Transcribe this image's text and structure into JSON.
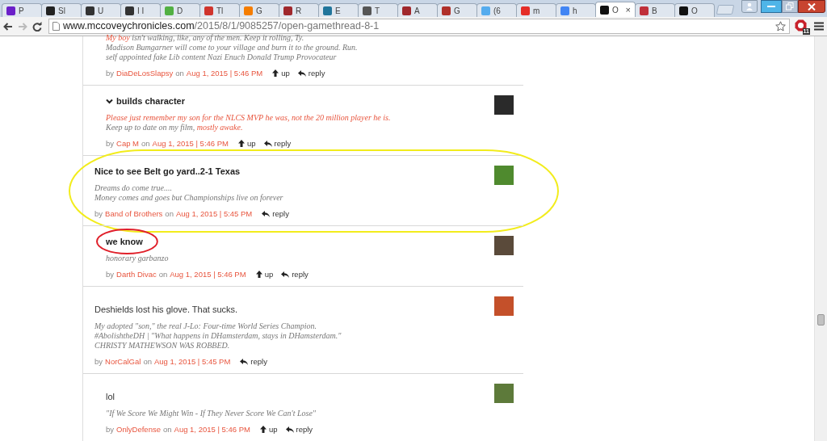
{
  "browser": {
    "tabs": [
      {
        "title": "P",
        "color": "#6b1fc9",
        "selected": false
      },
      {
        "title": "Sl",
        "color": "#222222",
        "selected": false
      },
      {
        "title": "U",
        "color": "#333333",
        "selected": false
      },
      {
        "title": "I I",
        "color": "#333333",
        "selected": false
      },
      {
        "title": "D",
        "color": "#52b043",
        "selected": false
      },
      {
        "title": "Tl",
        "color": "#d0342c",
        "selected": false
      },
      {
        "title": "G",
        "color": "#f57d00",
        "selected": false
      },
      {
        "title": "R",
        "color": "#a0282c",
        "selected": false
      },
      {
        "title": "E",
        "color": "#21759b",
        "selected": false
      },
      {
        "title": "T",
        "color": "#555555",
        "selected": false
      },
      {
        "title": "A",
        "color": "#a0282c",
        "selected": false
      },
      {
        "title": "G",
        "color": "#b0302a",
        "selected": false
      },
      {
        "title": "(6",
        "color": "#55acee",
        "selected": false
      },
      {
        "title": "m",
        "color": "#e52d27",
        "selected": false
      },
      {
        "title": "h",
        "color": "#4285f4",
        "selected": false
      },
      {
        "title": "O",
        "color": "#111111",
        "selected": true,
        "close": "×"
      },
      {
        "title": "B",
        "color": "#c0303a",
        "selected": false
      },
      {
        "title": "O",
        "color": "#111111",
        "selected": false
      }
    ],
    "url_host": "www.mccoveychronicles.com",
    "url_path": "/2015/8/1/9085257/open-gamethread-8-1",
    "forward_disabled": true,
    "extension_badge": "11"
  },
  "comments": [
    {
      "children": [
        {
          "signature": [
            [
              {
                "text": "My boy",
                "link": true
              },
              {
                "text": " isn't walking, like, any of the men. Keep it rolling, Ty.",
                "link": false
              }
            ],
            [
              {
                "text": "Madison Bumgarner will come to your village and burn it to the ground. Run.",
                "link": false
              }
            ],
            [
              {
                "text": "self appointed fake Lib content Nazi Enuch Donald Trump Provocateur",
                "link": false
              }
            ]
          ],
          "by": "by",
          "author": "DiaDeLosSlapsy",
          "on": "on",
          "date": "Aug 1, 2015 | 5:46 PM",
          "actions": [
            {
              "kind": "up",
              "label": "up"
            },
            {
              "kind": "reply",
              "label": "reply"
            }
          ]
        },
        {
          "title": "builds character",
          "title_bold": true,
          "expanded": true,
          "color": "#2a2a2a",
          "signature": [
            [
              {
                "text": "Please just remember my son for the NLCS MVP he was, not the 20 million player he is.",
                "link": true
              }
            ],
            [
              {
                "text": "Keep up to date on my film, ",
                "link": false
              },
              {
                "text": "mostly awake.",
                "link": true
              }
            ]
          ],
          "by": "by",
          "author": "Cap M",
          "on": "on",
          "date": "Aug 1, 2015 | 5:46 PM",
          "actions": [
            {
              "kind": "up",
              "label": "up"
            },
            {
              "kind": "reply",
              "label": "reply"
            }
          ]
        }
      ]
    },
    {
      "title": "Nice to see Belt go yard..2-1 Texas",
      "title_bold": true,
      "color": "#4f8a2e",
      "marker": {
        "color": "#f2ec1c"
      },
      "signature": [
        [
          {
            "text": "Dreams do come true....",
            "link": false
          }
        ],
        [
          {
            "text": "Money comes and goes but Championships live on forever",
            "link": false
          }
        ]
      ],
      "by": "by",
      "author": "Band of Brothers",
      "on": "on",
      "date": "Aug 1, 2015 | 5:45 PM",
      "actions": [
        {
          "kind": "reply",
          "label": "reply"
        }
      ],
      "children": [
        {
          "title": "we know",
          "title_bold": true,
          "color": "#5a4a3a",
          "title_marker": {
            "color": "#e0202a"
          },
          "signature": [
            [
              {
                "text": "honorary garbanzo",
                "link": false
              }
            ]
          ],
          "by": "by",
          "author": "Darth Divac",
          "on": "on",
          "date": "Aug 1, 2015 | 5:46 PM",
          "actions": [
            {
              "kind": "up",
              "label": "up"
            },
            {
              "kind": "reply",
              "label": "reply"
            }
          ]
        }
      ]
    },
    {
      "title": "Deshields lost his glove. That sucks.",
      "title_bold": false,
      "color": "#c4502a",
      "signature": [
        [
          {
            "text": "My adopted \"son,\" the real J-Lo: Four-time World Series Champion.",
            "link": false
          }
        ],
        [
          {
            "text": "#AbolishtheDH | \"What happens in DHamsterdam, stays in DHamsterdam.\"",
            "link": false
          }
        ],
        [
          {
            "text": "CHRISTY MATHEWSON WAS ROBBED.",
            "link": false
          }
        ]
      ],
      "by": "by",
      "author": "NorCalGal",
      "on": "on",
      "date": "Aug 1, 2015 | 5:45 PM",
      "actions": [
        {
          "kind": "reply",
          "label": "reply"
        }
      ],
      "children": [
        {
          "title": "lol",
          "title_bold": false,
          "color": "#5d7a3a",
          "signature": [
            [
              {
                "text": "\"If We Score We Might Win - If They Never Score We Can't Lose\"",
                "link": false
              }
            ]
          ],
          "by": "by",
          "author": "OnlyDefense",
          "on": "on",
          "date": "Aug 1, 2015 | 5:46 PM",
          "actions": [
            {
              "kind": "up",
              "label": "up"
            },
            {
              "kind": "reply",
              "label": "reply"
            }
          ]
        }
      ]
    }
  ]
}
